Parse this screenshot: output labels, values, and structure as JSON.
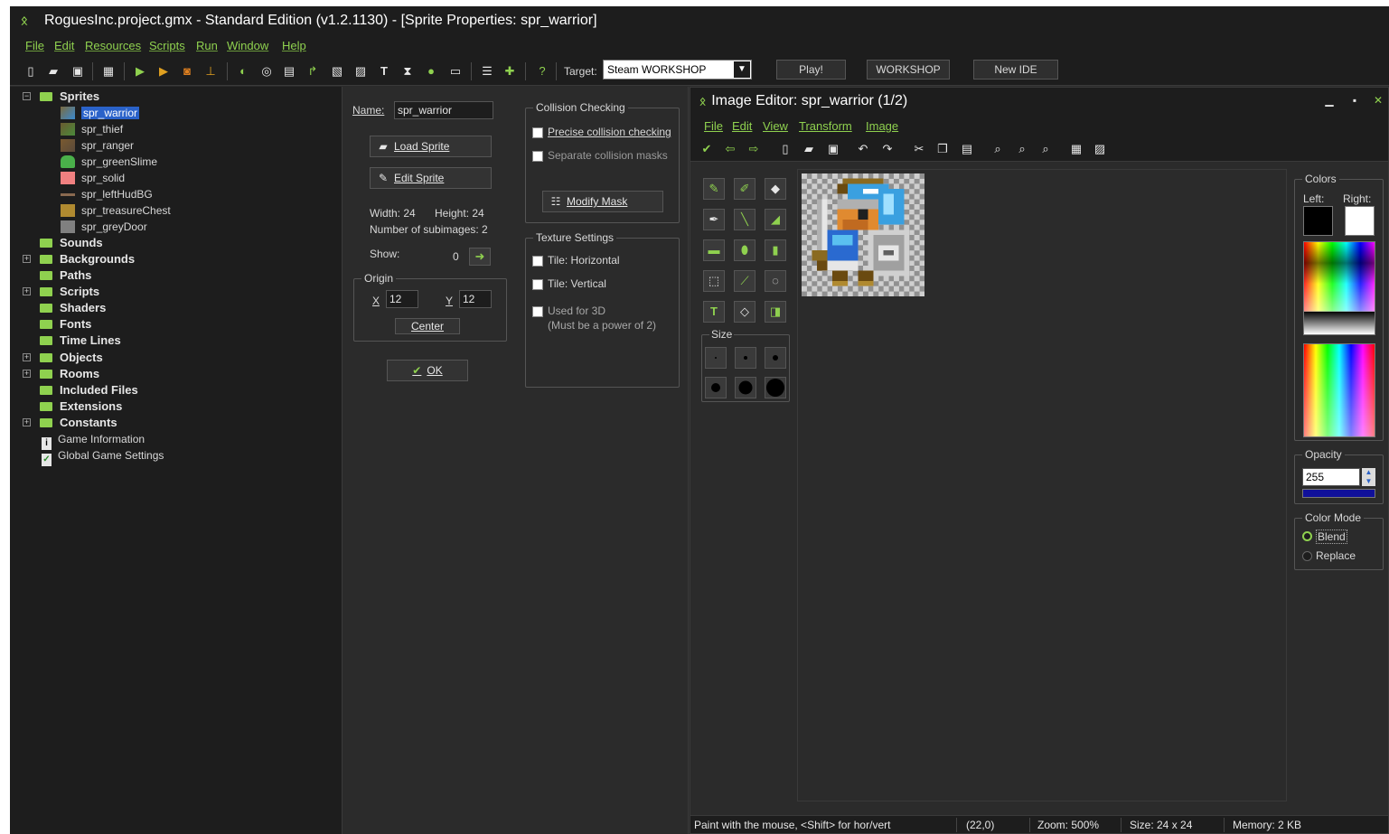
{
  "window": {
    "title": "RoguesInc.project.gmx  -  Standard Edition (v1.2.1130) - [Sprite Properties: spr_warrior]",
    "logo_glyph": "ᛟ"
  },
  "menu": [
    "File",
    "Edit",
    "Resources",
    "Scripts",
    "Run",
    "Window",
    "Help"
  ],
  "toolbar": {
    "target_label": "Target:",
    "target_value": "Steam WORKSHOP",
    "play_label": "Play!",
    "workshop_label": "WORKSHOP",
    "newide_label": "New IDE"
  },
  "tree": {
    "sprites_label": "Sprites",
    "sprite_items": [
      "spr_warrior",
      "spr_thief",
      "spr_ranger",
      "spr_greenSlime",
      "spr_solid",
      "spr_leftHudBG",
      "spr_treasureChest",
      "spr_greyDoor"
    ],
    "folders": [
      "Sounds",
      "Backgrounds",
      "Paths",
      "Scripts",
      "Shaders",
      "Fonts",
      "Time Lines",
      "Objects",
      "Rooms",
      "Included Files",
      "Extensions",
      "Constants"
    ],
    "game_information": "Game Information",
    "global_game_settings": "Global Game Settings"
  },
  "sprite_props": {
    "name_label": "Name:",
    "name_value": "spr_warrior",
    "load_sprite": "Load Sprite",
    "edit_sprite": "Edit Sprite",
    "width_text": "Width: 24",
    "height_text": "Height: 24",
    "subimages_text": "Number of subimages: 2",
    "show_label": "Show:",
    "show_value": "0",
    "origin_label": "Origin",
    "x_label": "X",
    "x_value": "12",
    "y_label": "Y",
    "y_value": "12",
    "center_label": "Center",
    "ok_label": "OK",
    "collision_title": "Collision Checking",
    "precise_label": "Precise collision checking",
    "separate_label": "Separate collision masks",
    "modify_mask": "Modify Mask",
    "texture_title": "Texture Settings",
    "tile_h": "Tile: Horizontal",
    "tile_v": "Tile: Vertical",
    "used_3d": "Used for 3D",
    "power_of_2": "(Must be a power of 2)"
  },
  "image_editor": {
    "title": "Image Editor: spr_warrior (1/2)",
    "menu": [
      "File",
      "Edit",
      "View",
      "Transform",
      "Image"
    ],
    "size_label": "Size",
    "colors_label": "Colors",
    "left_label": "Left:",
    "right_label": "Right:",
    "opacity_label": "Opacity",
    "opacity_value": "255",
    "color_mode_label": "Color Mode",
    "blend_label": "Blend",
    "replace_label": "Replace",
    "status_hint": "Paint with the mouse, <Shift> for hor/vert",
    "status_coords": "(22,0)",
    "status_zoom": "Zoom: 500%",
    "status_size": "Size: 24 x 24",
    "status_memory": "Memory: 2 KB"
  },
  "colors": {
    "accent_green": "#8fd14f",
    "selection_blue": "#2a62c9",
    "left_color": "#000000",
    "right_color": "#ffffff"
  }
}
